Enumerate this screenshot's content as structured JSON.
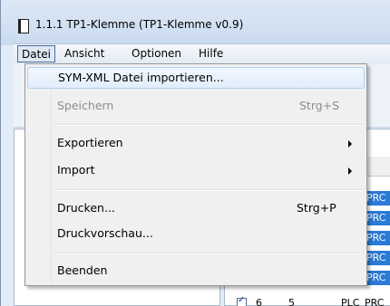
{
  "window": {
    "title": "1.1.1  TP1-Klemme (TP1-Klemme v0.9)"
  },
  "menubar": {
    "items": [
      {
        "label": "Datei"
      },
      {
        "label": "Ansicht"
      },
      {
        "label": "Optionen"
      },
      {
        "label": "Hilfe"
      }
    ]
  },
  "datei_menu": {
    "items": [
      {
        "label": "SYM-XML Datei importieren...",
        "shortcut": "",
        "enabled": true,
        "submenu": false
      },
      {
        "label": "Speichern",
        "shortcut": "Strg+S",
        "enabled": false,
        "submenu": false
      },
      {
        "label": "Exportieren",
        "shortcut": "",
        "enabled": true,
        "submenu": true
      },
      {
        "label": "Import",
        "shortcut": "",
        "enabled": true,
        "submenu": true
      },
      {
        "label": "Drucken...",
        "shortcut": "Strg+P",
        "enabled": true,
        "submenu": false
      },
      {
        "label": "Druckvorschau...",
        "shortcut": "",
        "enabled": true,
        "submenu": false
      },
      {
        "label": "Beenden",
        "shortcut": "",
        "enabled": true,
        "submenu": false
      }
    ]
  },
  "grid": {
    "header_tail": "e",
    "row_tail": "PRC",
    "last_row": {
      "col1": "6",
      "col2": "5",
      "col3": "PLC",
      "col4": "PRC"
    }
  }
}
